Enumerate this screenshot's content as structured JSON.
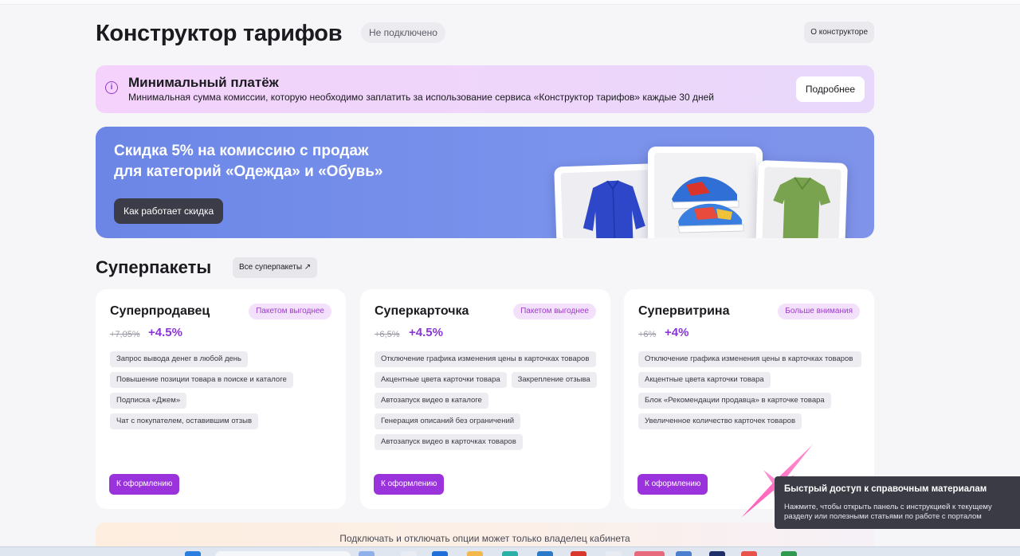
{
  "header": {
    "title": "Конструктор тарифов",
    "status": "Не подключено",
    "about_label": "О конструкторе"
  },
  "info_banner": {
    "title": "Минимальный платёж",
    "text": "Минимальная сумма комиссии, которую необходимо заплатить за использование сервиса «Конструктор тарифов» каждые 30 дней",
    "button": "Подробнее",
    "icon": "info-icon"
  },
  "promo": {
    "title_line1": "Скидка 5% на комиссию с продаж",
    "title_line2": "для категорий «Одежда» и «Обувь»",
    "button": "Как работает скидка"
  },
  "section": {
    "title": "Суперпакеты",
    "all_label": "Все суперпакеты ↗"
  },
  "cards": [
    {
      "title": "Суперпродавец",
      "badge": "Пакетом выгоднее",
      "old_price": "+7,05%",
      "new_price": "+4.5%",
      "features": [
        "Запрос вывода денег в любой день",
        "Повышение позиции товара в поиске и каталоге",
        "Подписка «Джем»",
        "Чат с покупателем, оставившим отзыв"
      ],
      "button": "К оформлению"
    },
    {
      "title": "Суперкарточка",
      "badge": "Пакетом выгоднее",
      "old_price": "+6,5%",
      "new_price": "+4.5%",
      "features": [
        "Отключение графика изменения цены в карточках товаров",
        "Акцентные цвета карточки товара",
        "Закрепление отзыва",
        "Автозапуск видео в каталоге",
        "Генерация описаний без ограничений",
        "Автозапуск видео в карточках товаров"
      ],
      "button": "К оформлению"
    },
    {
      "title": "Супервитрина",
      "badge": "Больше внимания",
      "old_price": "+6%",
      "new_price": "+4%",
      "features": [
        "Отключение графика изменения цены в карточках товаров",
        "Акцентные цвета карточки товара",
        "Блок «Рекомендации продавца» в карточке товара",
        "Увеличенное количество карточек товаров"
      ],
      "button": "К оформлению"
    }
  ],
  "bottom_notice": "Подключать и отключать опции может только владелец кабинета",
  "tooltip": {
    "title": "Быстрый доступ к справочным материалам",
    "text": "Нажмите, чтобы открыть панель с инструкцией к текущему разделу или полезными статьями по работе с порталом"
  },
  "colors": {
    "accent": "#9a33dc",
    "price": "#8a35d6",
    "promo_bg": "#7a93ec",
    "tooltip_bg": "#3a3b45"
  }
}
